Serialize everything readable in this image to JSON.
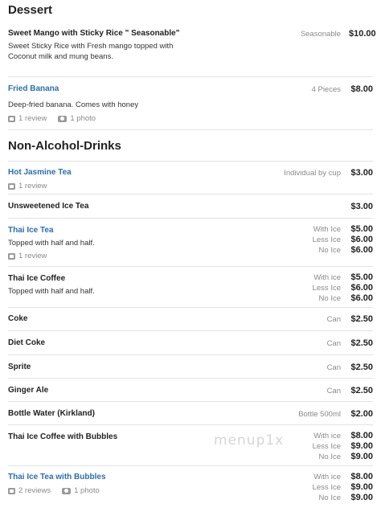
{
  "sections": [
    {
      "title": "Dessert",
      "items": [
        {
          "name": "Sweet Mango with Sticky Rice \" Seasonable\"",
          "link": false,
          "desc": "Sweet Sticky Rice with Fresh mango topped with Coconut milk and mung beans.",
          "prices": [
            {
              "size": "Seasonable",
              "price": "$10.00"
            }
          ]
        },
        {
          "name": "Fried Banana",
          "link": true,
          "desc": "Deep-fried banana. Comes with honey",
          "reviews": "1 review",
          "photos": "1 photo",
          "prices": [
            {
              "size": "4 Pieces",
              "price": "$8.00"
            }
          ]
        }
      ]
    },
    {
      "title": "Non-Alcohol-Drinks",
      "items": [
        {
          "name": "Hot Jasmine Tea",
          "link": true,
          "reviews": "1 review",
          "prices": [
            {
              "size": "Individual by cup",
              "price": "$3.00"
            }
          ]
        },
        {
          "name": "Unsweetened Ice Tea",
          "link": false,
          "prices": [
            {
              "size": "",
              "price": "$3.00"
            }
          ]
        },
        {
          "name": "Thai Ice Tea",
          "link": true,
          "desc": "Topped with half and half.",
          "reviews": "1 review",
          "prices": [
            {
              "size": "With Ice",
              "price": "$5.00"
            },
            {
              "size": "Less Ice",
              "price": "$6.00"
            },
            {
              "size": "No Ice",
              "price": "$6.00"
            }
          ]
        },
        {
          "name": "Thai Ice Coffee",
          "link": false,
          "desc": "Topped with half and half.",
          "prices": [
            {
              "size": "With ice",
              "price": "$5.00"
            },
            {
              "size": "Less Ice",
              "price": "$6.00"
            },
            {
              "size": "No Ice",
              "price": "$6.00"
            }
          ]
        },
        {
          "name": "Coke",
          "link": false,
          "prices": [
            {
              "size": "Can",
              "price": "$2.50"
            }
          ]
        },
        {
          "name": "Diet Coke",
          "link": false,
          "prices": [
            {
              "size": "Can",
              "price": "$2.50"
            }
          ]
        },
        {
          "name": "Sprite",
          "link": false,
          "prices": [
            {
              "size": "Can",
              "price": "$2.50"
            }
          ]
        },
        {
          "name": "Ginger Ale",
          "link": false,
          "prices": [
            {
              "size": "Can",
              "price": "$2.50"
            }
          ]
        },
        {
          "name": "Bottle Water (Kirkland)",
          "link": false,
          "prices": [
            {
              "size": "Bottle 500ml",
              "price": "$2.00"
            }
          ]
        },
        {
          "name": "Thai Ice Coffee with Bubbles",
          "link": false,
          "prices": [
            {
              "size": "With ice",
              "price": "$8.00"
            },
            {
              "size": "Less Ice",
              "price": "$9.00"
            },
            {
              "size": "No Ice",
              "price": "$9.00"
            }
          ]
        },
        {
          "name": "Thai Ice Tea with Bubbles",
          "link": true,
          "reviews": "2 reviews",
          "photos": "1 photo",
          "prices": [
            {
              "size": "With ice",
              "price": "$8.00"
            },
            {
              "size": "Less Ice",
              "price": "$9.00"
            },
            {
              "size": "No Ice",
              "price": "$9.00"
            }
          ]
        }
      ]
    }
  ],
  "watermark": "menup1x"
}
